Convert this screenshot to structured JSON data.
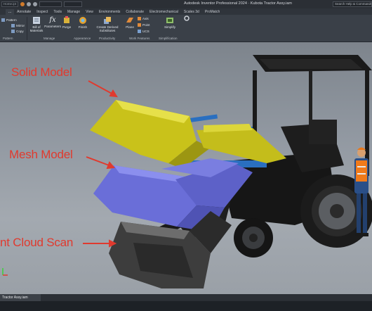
{
  "titlebar": {
    "qa_box_1": "Home.ipt",
    "title": "Autodesk Inventor Professional 2024  ·  Kubota Tractor Assy.iam",
    "search": "Search Help & Commands"
  },
  "tabs": [
    "...",
    "Annotate",
    "Inspect",
    "Tools",
    "Manage",
    "View",
    "Environments",
    "Collaborate",
    "Electromechanical",
    "Scales 3d",
    "ProMatch"
  ],
  "active_tab_index": 0,
  "ribbon": {
    "pattern_items": [
      "Pattern",
      "Mirror",
      "Copy"
    ],
    "bill_of_materials": "Bill of Materials",
    "parameters": "Parameters",
    "purge": "Purge",
    "finish": "Finish",
    "create_derived": "Create Derived Substitutes",
    "plane": "Plane",
    "axis": "Axis",
    "point": "Point",
    "ucs": "UCS",
    "simplify": "Simplify",
    "groups": [
      "Pattern",
      "Manage",
      "Appearance",
      "Productivity",
      "Work Features",
      "Simplification"
    ]
  },
  "annotations": {
    "solid_model": "Solid Model",
    "mesh_model": "Mesh Model",
    "point_cloud": "nt Cloud Scan"
  },
  "doc_tab": "Tractor Assy.iam",
  "colors": {
    "annotation_red": "#e03a2e",
    "solid_bucket": "#c9c21a",
    "mesh_bucket": "#6a6ed8",
    "ribbon_bg": "#3a4048"
  }
}
